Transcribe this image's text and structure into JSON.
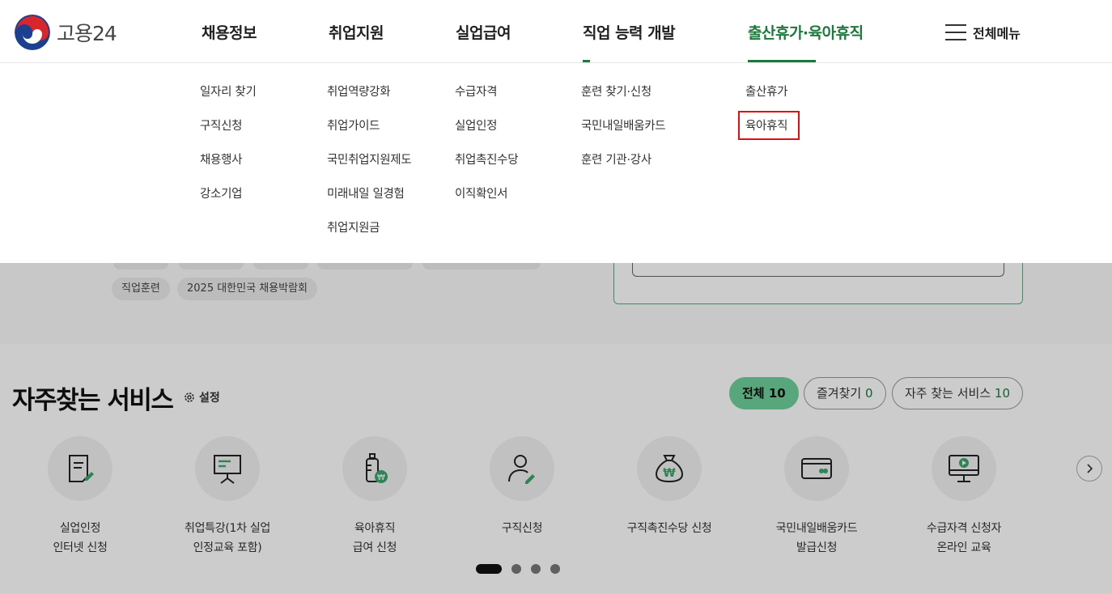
{
  "logo": {
    "text": "고용24"
  },
  "gnb": [
    {
      "label": "채용정보"
    },
    {
      "label": "취업지원"
    },
    {
      "label": "실업급여"
    },
    {
      "label": "직업 능력 개발"
    },
    {
      "label": "출산휴가·육아휴직"
    }
  ],
  "all_menu": {
    "label": "전체메뉴"
  },
  "mega_menu": [
    {
      "items": [
        "일자리 찾기",
        "구직신청",
        "채용행사",
        "강소기업"
      ]
    },
    {
      "items": [
        "취업역량강화",
        "취업가이드",
        "국민취업지원제도",
        "미래내일 일경험",
        "취업지원금"
      ]
    },
    {
      "items": [
        "수급자격",
        "실업인정",
        "취업촉진수당",
        "이직확인서"
      ]
    },
    {
      "items": [
        "훈련 찾기·신청",
        "국민내일배움카드",
        "훈련 기관·강사"
      ]
    },
    {
      "items": [
        "출산휴가",
        "육아휴직"
      ]
    }
  ],
  "keywords": [
    "직업훈련",
    "2025 대한민국 채용박람회"
  ],
  "services": {
    "title": "자주찾는 서비스",
    "setting_label": "설정",
    "filters": [
      {
        "label": "전체",
        "count": "10"
      },
      {
        "label": "즐겨찾기",
        "count": "0"
      },
      {
        "label": "자주 찾는 서비스",
        "count": "10"
      }
    ],
    "items": [
      {
        "icon": "document-edit-icon",
        "label": "실업인정\n인터넷 신청"
      },
      {
        "icon": "presentation-board-icon",
        "label": "취업특강(1차 실업\n인정교육 포함)"
      },
      {
        "icon": "baby-bottle-won-icon",
        "label": "육아휴직\n급여 신청"
      },
      {
        "icon": "person-edit-icon",
        "label": "구직신청"
      },
      {
        "icon": "money-bag-won-icon",
        "label": "구직촉진수당 신청"
      },
      {
        "icon": "credit-card-icon",
        "label": "국민내일배움카드\n발급신청"
      },
      {
        "icon": "monitor-play-icon",
        "label": "수급자격 신청자\n온라인 교육"
      }
    ],
    "pagination": {
      "pages": 4,
      "current": 1
    }
  },
  "colors": {
    "brand_green": "#1b7a3c",
    "active_filter": "#6fd09a",
    "highlight_box": "#e01010"
  }
}
